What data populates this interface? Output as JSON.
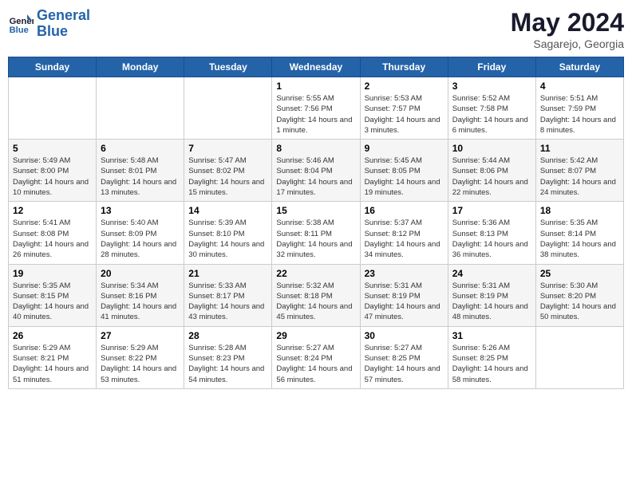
{
  "header": {
    "logo_line1": "General",
    "logo_line2": "Blue",
    "month": "May 2024",
    "location": "Sagarejo, Georgia"
  },
  "days_of_week": [
    "Sunday",
    "Monday",
    "Tuesday",
    "Wednesday",
    "Thursday",
    "Friday",
    "Saturday"
  ],
  "weeks": [
    [
      {
        "day": "",
        "info": ""
      },
      {
        "day": "",
        "info": ""
      },
      {
        "day": "",
        "info": ""
      },
      {
        "day": "1",
        "info": "Sunrise: 5:55 AM\nSunset: 7:56 PM\nDaylight: 14 hours and 1 minute."
      },
      {
        "day": "2",
        "info": "Sunrise: 5:53 AM\nSunset: 7:57 PM\nDaylight: 14 hours and 3 minutes."
      },
      {
        "day": "3",
        "info": "Sunrise: 5:52 AM\nSunset: 7:58 PM\nDaylight: 14 hours and 6 minutes."
      },
      {
        "day": "4",
        "info": "Sunrise: 5:51 AM\nSunset: 7:59 PM\nDaylight: 14 hours and 8 minutes."
      }
    ],
    [
      {
        "day": "5",
        "info": "Sunrise: 5:49 AM\nSunset: 8:00 PM\nDaylight: 14 hours and 10 minutes."
      },
      {
        "day": "6",
        "info": "Sunrise: 5:48 AM\nSunset: 8:01 PM\nDaylight: 14 hours and 13 minutes."
      },
      {
        "day": "7",
        "info": "Sunrise: 5:47 AM\nSunset: 8:02 PM\nDaylight: 14 hours and 15 minutes."
      },
      {
        "day": "8",
        "info": "Sunrise: 5:46 AM\nSunset: 8:04 PM\nDaylight: 14 hours and 17 minutes."
      },
      {
        "day": "9",
        "info": "Sunrise: 5:45 AM\nSunset: 8:05 PM\nDaylight: 14 hours and 19 minutes."
      },
      {
        "day": "10",
        "info": "Sunrise: 5:44 AM\nSunset: 8:06 PM\nDaylight: 14 hours and 22 minutes."
      },
      {
        "day": "11",
        "info": "Sunrise: 5:42 AM\nSunset: 8:07 PM\nDaylight: 14 hours and 24 minutes."
      }
    ],
    [
      {
        "day": "12",
        "info": "Sunrise: 5:41 AM\nSunset: 8:08 PM\nDaylight: 14 hours and 26 minutes."
      },
      {
        "day": "13",
        "info": "Sunrise: 5:40 AM\nSunset: 8:09 PM\nDaylight: 14 hours and 28 minutes."
      },
      {
        "day": "14",
        "info": "Sunrise: 5:39 AM\nSunset: 8:10 PM\nDaylight: 14 hours and 30 minutes."
      },
      {
        "day": "15",
        "info": "Sunrise: 5:38 AM\nSunset: 8:11 PM\nDaylight: 14 hours and 32 minutes."
      },
      {
        "day": "16",
        "info": "Sunrise: 5:37 AM\nSunset: 8:12 PM\nDaylight: 14 hours and 34 minutes."
      },
      {
        "day": "17",
        "info": "Sunrise: 5:36 AM\nSunset: 8:13 PM\nDaylight: 14 hours and 36 minutes."
      },
      {
        "day": "18",
        "info": "Sunrise: 5:35 AM\nSunset: 8:14 PM\nDaylight: 14 hours and 38 minutes."
      }
    ],
    [
      {
        "day": "19",
        "info": "Sunrise: 5:35 AM\nSunset: 8:15 PM\nDaylight: 14 hours and 40 minutes."
      },
      {
        "day": "20",
        "info": "Sunrise: 5:34 AM\nSunset: 8:16 PM\nDaylight: 14 hours and 41 minutes."
      },
      {
        "day": "21",
        "info": "Sunrise: 5:33 AM\nSunset: 8:17 PM\nDaylight: 14 hours and 43 minutes."
      },
      {
        "day": "22",
        "info": "Sunrise: 5:32 AM\nSunset: 8:18 PM\nDaylight: 14 hours and 45 minutes."
      },
      {
        "day": "23",
        "info": "Sunrise: 5:31 AM\nSunset: 8:19 PM\nDaylight: 14 hours and 47 minutes."
      },
      {
        "day": "24",
        "info": "Sunrise: 5:31 AM\nSunset: 8:19 PM\nDaylight: 14 hours and 48 minutes."
      },
      {
        "day": "25",
        "info": "Sunrise: 5:30 AM\nSunset: 8:20 PM\nDaylight: 14 hours and 50 minutes."
      }
    ],
    [
      {
        "day": "26",
        "info": "Sunrise: 5:29 AM\nSunset: 8:21 PM\nDaylight: 14 hours and 51 minutes."
      },
      {
        "day": "27",
        "info": "Sunrise: 5:29 AM\nSunset: 8:22 PM\nDaylight: 14 hours and 53 minutes."
      },
      {
        "day": "28",
        "info": "Sunrise: 5:28 AM\nSunset: 8:23 PM\nDaylight: 14 hours and 54 minutes."
      },
      {
        "day": "29",
        "info": "Sunrise: 5:27 AM\nSunset: 8:24 PM\nDaylight: 14 hours and 56 minutes."
      },
      {
        "day": "30",
        "info": "Sunrise: 5:27 AM\nSunset: 8:25 PM\nDaylight: 14 hours and 57 minutes."
      },
      {
        "day": "31",
        "info": "Sunrise: 5:26 AM\nSunset: 8:25 PM\nDaylight: 14 hours and 58 minutes."
      },
      {
        "day": "",
        "info": ""
      }
    ]
  ]
}
